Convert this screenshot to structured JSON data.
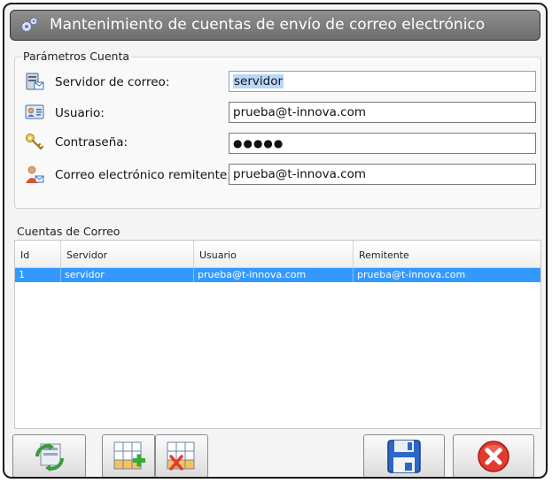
{
  "window": {
    "title": "Mantenimiento de cuentas de envío de correo electrónico",
    "title_icon": "gears-icon"
  },
  "params": {
    "group_title": "Parámetros Cuenta",
    "server_label": "Servidor de correo:",
    "server_value": "servidor",
    "user_label": "Usuario:",
    "user_value": "prueba@t-innova.com",
    "password_label": "Contraseña:",
    "password_value": "●●●●●",
    "sender_label": "Correo electrónico remitente:",
    "sender_value": "prueba@t-innova.com"
  },
  "accounts": {
    "group_title": "Cuentas de Correo",
    "columns": [
      "Id",
      "Servidor",
      "Usuario",
      "Remitente"
    ],
    "rows": [
      {
        "id": "1",
        "servidor": "servidor",
        "usuario": "prueba@t-innova.com",
        "remitente": "prueba@t-innova.com"
      }
    ]
  },
  "toolbar": {
    "buttons": [
      "refresh-icon",
      "add-row-icon",
      "delete-row-icon",
      "save-icon",
      "close-icon"
    ]
  },
  "colors": {
    "title_bar": "#7a7a7a",
    "selection": "#3399ff",
    "close_red": "#e23b2e"
  }
}
